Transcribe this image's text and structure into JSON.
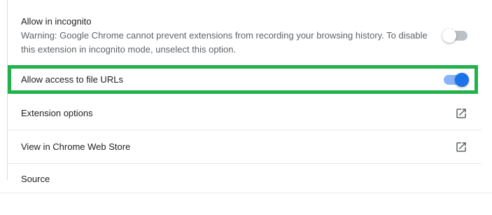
{
  "colors": {
    "highlight": "#22b14c",
    "toggle_on": "#1a73e8",
    "toggle_on_track": "#8ab4f8",
    "toggle_off_track": "#bdc1c6"
  },
  "settings": {
    "incognito": {
      "label": "Allow in incognito",
      "warning": "Warning: Google Chrome cannot prevent extensions from recording your browsing history. To disable this extension in incognito mode, unselect this option.",
      "enabled": false
    },
    "file_urls": {
      "label": "Allow access to file URLs",
      "enabled": true
    },
    "extension_options": {
      "label": "Extension options",
      "icon": "open-in-new-icon"
    },
    "web_store": {
      "label": "View in Chrome Web Store",
      "icon": "open-in-new-icon"
    },
    "source": {
      "label": "Source"
    }
  }
}
